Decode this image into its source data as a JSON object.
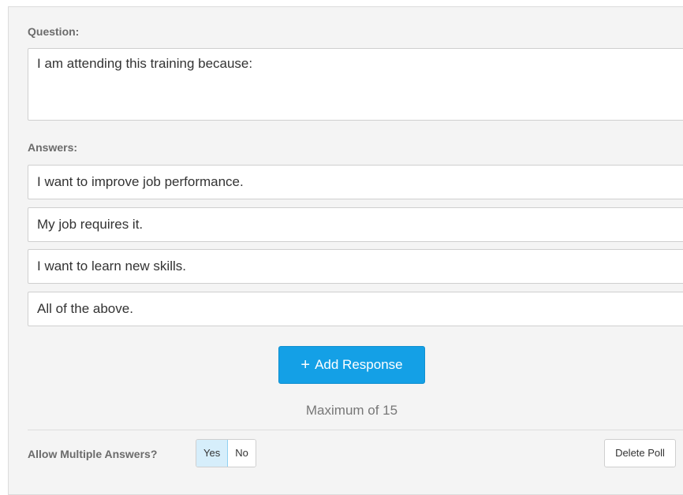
{
  "question": {
    "label": "Question:",
    "value": "I am attending this training because:"
  },
  "answers": {
    "label": "Answers:",
    "items": [
      "I want to improve job performance.",
      "My job requires it.",
      "I want to learn new skills.",
      "All of the above."
    ]
  },
  "add_response": {
    "icon": "plus-icon",
    "icon_glyph": "+",
    "label": "Add Response",
    "color": "#14a0e6"
  },
  "maximum_text": "Maximum of 15",
  "allow_multiple": {
    "label": "Allow Multiple Answers?",
    "options": [
      "Yes",
      "No"
    ],
    "selected": "Yes"
  },
  "delete_poll_label": "Delete Poll"
}
